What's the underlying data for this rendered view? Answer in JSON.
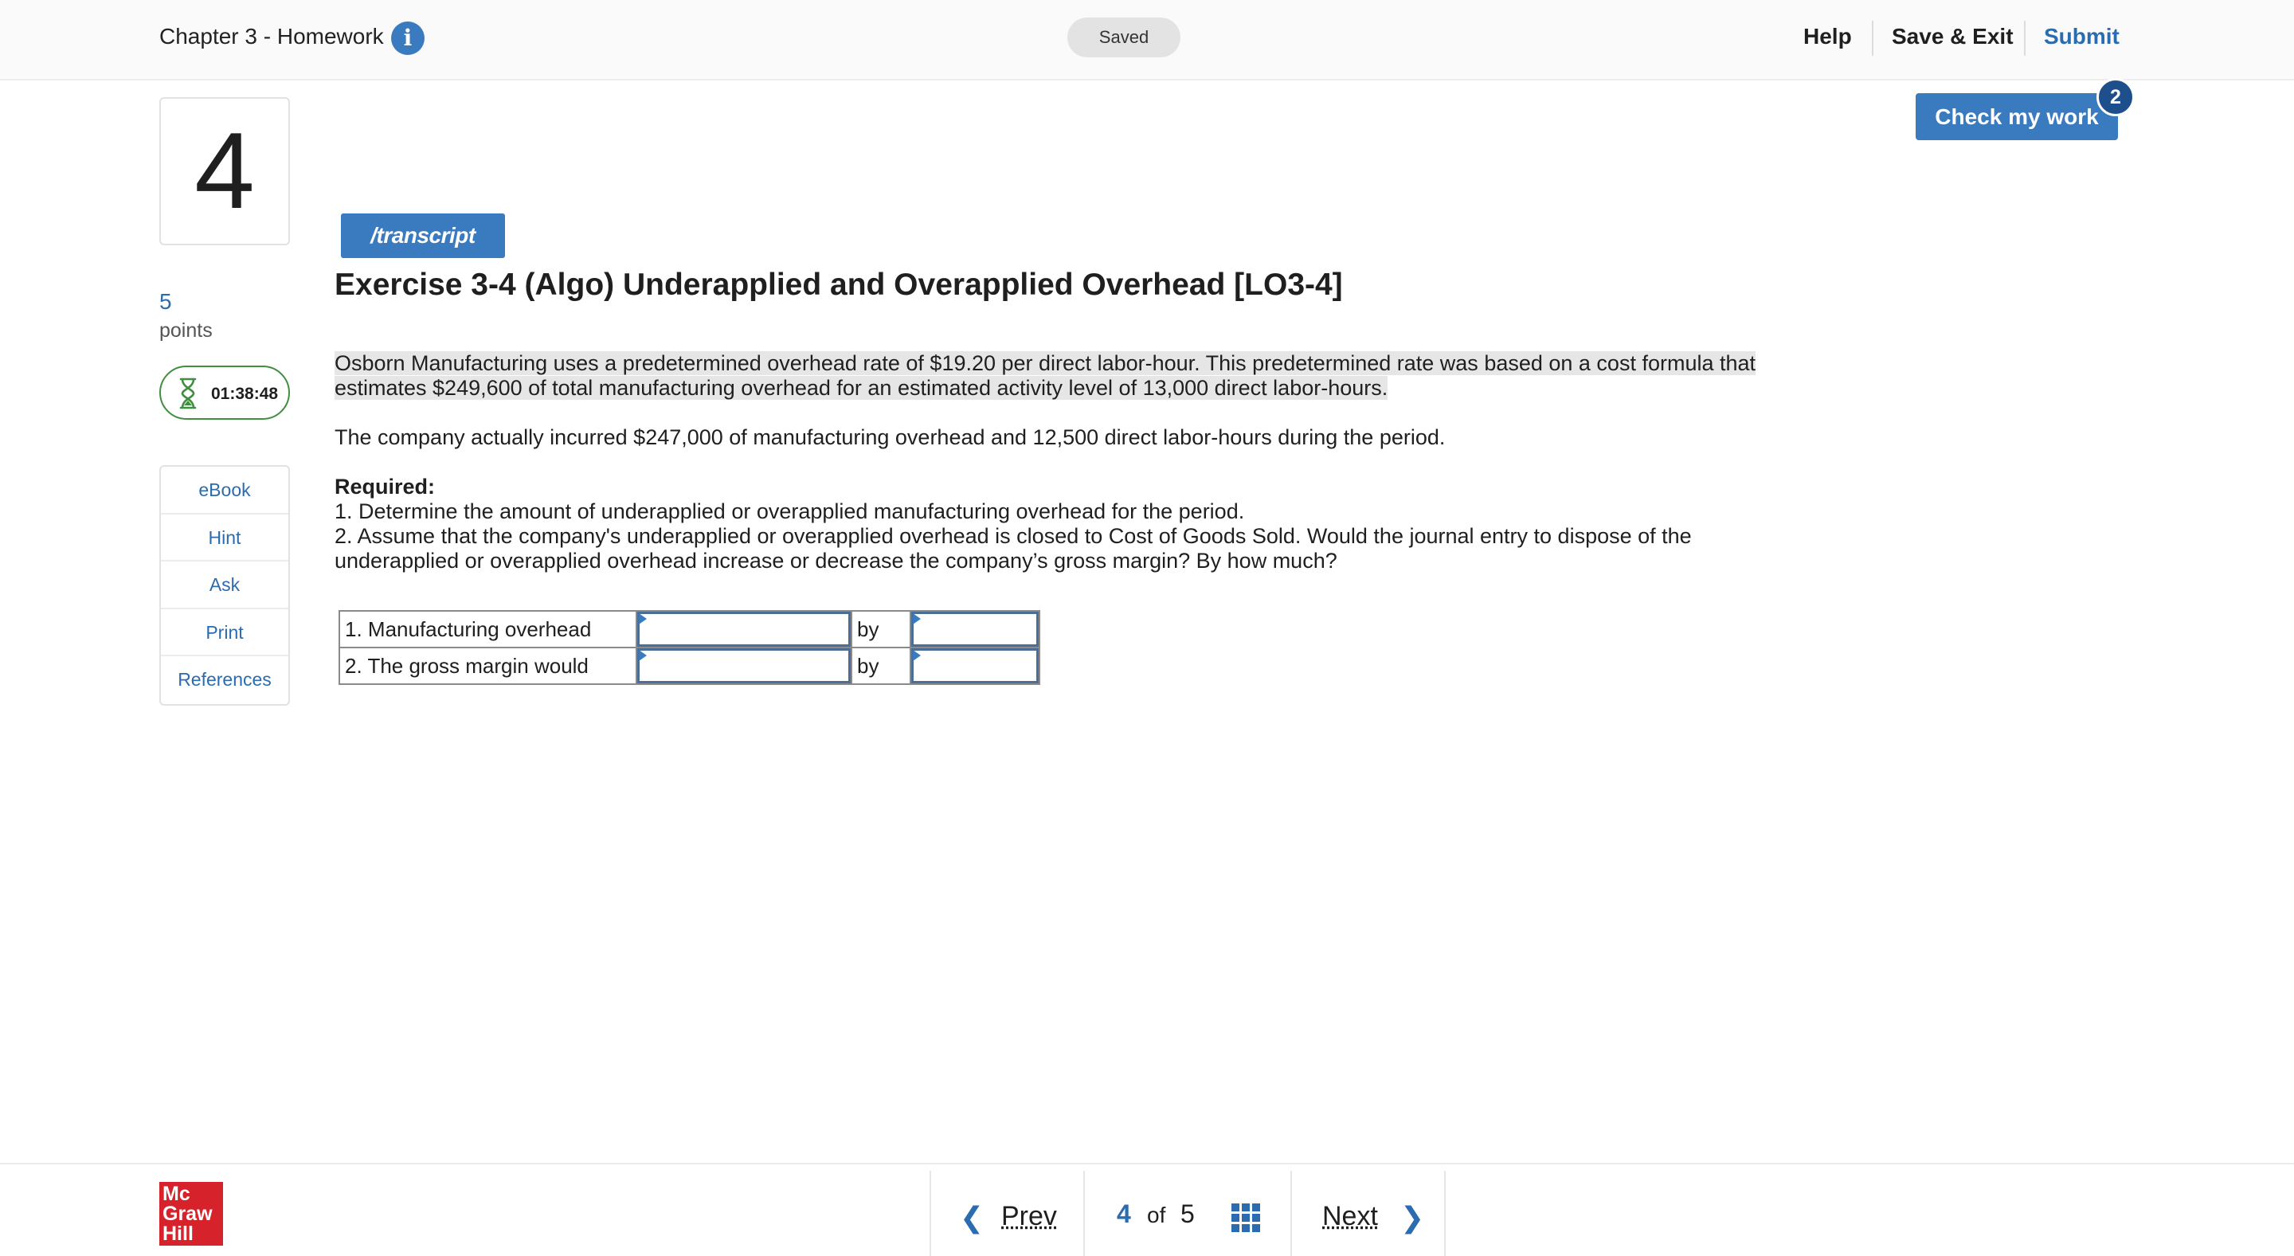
{
  "header": {
    "title": "Chapter 3 - Homework",
    "info_icon": "i",
    "status": "Saved",
    "help": "Help",
    "save_exit": "Save & Exit",
    "submit": "Submit"
  },
  "question": {
    "number": "4",
    "points_value": "5",
    "points_label": "points",
    "timer": "01:38:48"
  },
  "tools": [
    "eBook",
    "Hint",
    "Ask",
    "Print",
    "References"
  ],
  "check_work": {
    "label": "Check my work",
    "badge": "2"
  },
  "transcript_label": "/transcript",
  "exercise": {
    "title": "Exercise 3-4 (Algo) Underapplied and Overapplied Overhead [LO3-4]",
    "para1_line1": "Osborn Manufacturing uses a predetermined overhead rate of $19.20 per direct labor-hour. This predetermined rate was based on a cost formula that",
    "para1_line2": "estimates $249,600 of total manufacturing overhead for an estimated activity level of 13,000 direct labor-hours.",
    "para2": "The company actually incurred $247,000 of manufacturing overhead and 12,500 direct labor-hours during the period.",
    "required_label": "Required:",
    "req1": "1. Determine the amount of underapplied or overapplied manufacturing overhead for the period.",
    "req2_line1": "2. Assume that the company's underapplied or overapplied overhead is closed to Cost of Goods Sold. Would the journal entry to dispose of the",
    "req2_line2": "underapplied or overapplied overhead increase or decrease the company’s gross margin? By how much?"
  },
  "answer_table": {
    "rows": [
      {
        "label": "1. Manufacturing overhead",
        "dropdown_value": "",
        "by": "by",
        "amount": ""
      },
      {
        "label": "2. The gross margin would",
        "dropdown_value": "",
        "by": "by",
        "amount": ""
      }
    ]
  },
  "footer": {
    "logo_lines": [
      "Mc",
      "Graw",
      "Hill"
    ],
    "prev": "Prev",
    "current_page": "4",
    "of": "of",
    "total_pages": "5",
    "next": "Next"
  },
  "colors": {
    "accent": "#3a7abf",
    "accent_dark": "#1d4f8c",
    "link": "#2b6cb0",
    "timer_border": "#3f8f3f",
    "logo": "#d6222b"
  }
}
